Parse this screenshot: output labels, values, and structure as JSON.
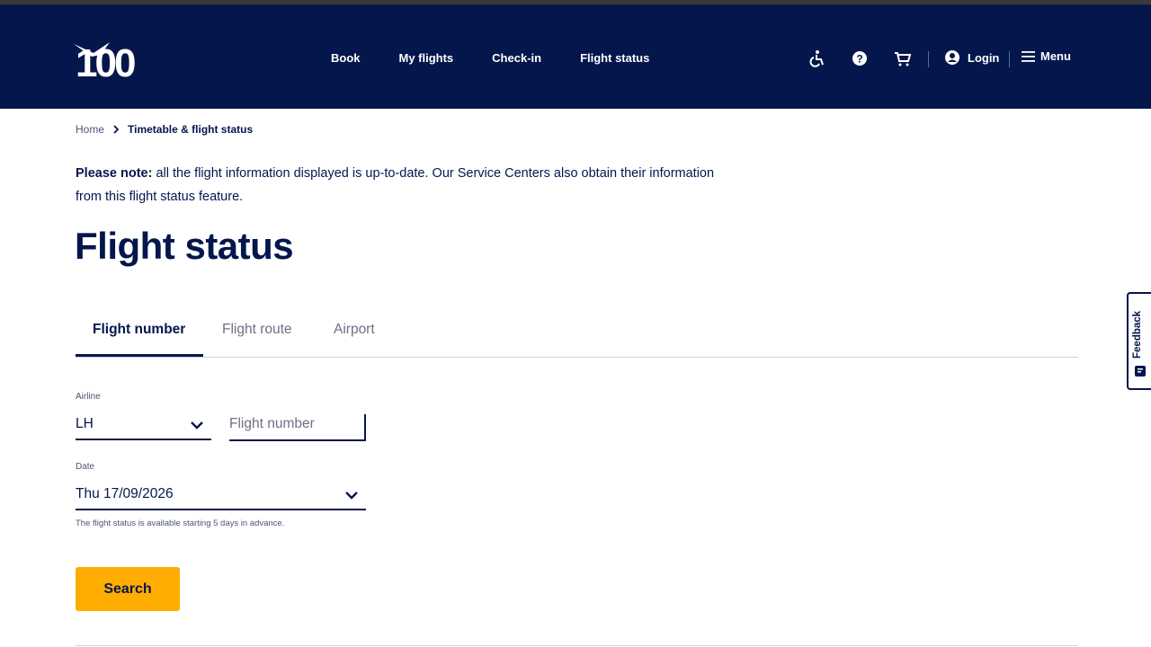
{
  "header": {
    "logo_text": "100",
    "nav": [
      "Book",
      "My flights",
      "Check-in",
      "Flight status"
    ],
    "icons": [
      "accessibility-icon",
      "help-icon",
      "cart-icon",
      "user-icon",
      "menu-icon"
    ],
    "login_label": "Login",
    "menu_label": "Menu"
  },
  "breadcrumb": {
    "home": "Home",
    "current": "Timetable & flight status"
  },
  "notice": {
    "bold": "Please note:",
    "text": " all the flight information displayed is up-to-date. Our Service Centers also obtain their information from this flight status feature."
  },
  "page_title": "Flight status",
  "tabs": [
    {
      "label": "Flight number",
      "active": true
    },
    {
      "label": "Flight route",
      "active": false
    },
    {
      "label": "Airport",
      "active": false
    }
  ],
  "form": {
    "airline_label": "Airline",
    "airline_value": "LH",
    "flight_number_placeholder": "Flight number",
    "date_label": "Date",
    "date_value": "Thu 17/09/2026",
    "hint": "The flight status is available starting 5 days in advance.",
    "search_label": "Search"
  },
  "feedback_label": "Feedback",
  "colors": {
    "brand_navy": "#05164d",
    "accent_yellow": "#ffad00"
  }
}
